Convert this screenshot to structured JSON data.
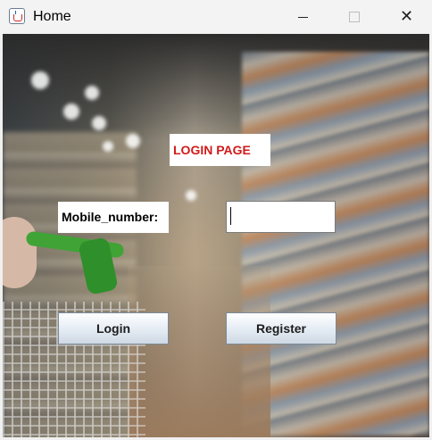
{
  "window": {
    "title": "Home",
    "controls": {
      "minimize": "minimize-icon",
      "maximize": "maximize-icon",
      "close": "close-icon"
    }
  },
  "form": {
    "heading": "LOGIN PAGE",
    "mobile_label": "Mobile_number:",
    "mobile_value": "",
    "login_label": "Login",
    "register_label": "Register"
  },
  "colors": {
    "heading": "#d11a1a",
    "titlebar": "#f3f3f3",
    "button_gradient_top": "#ffffff",
    "button_gradient_bottom": "#cfd9e4"
  }
}
